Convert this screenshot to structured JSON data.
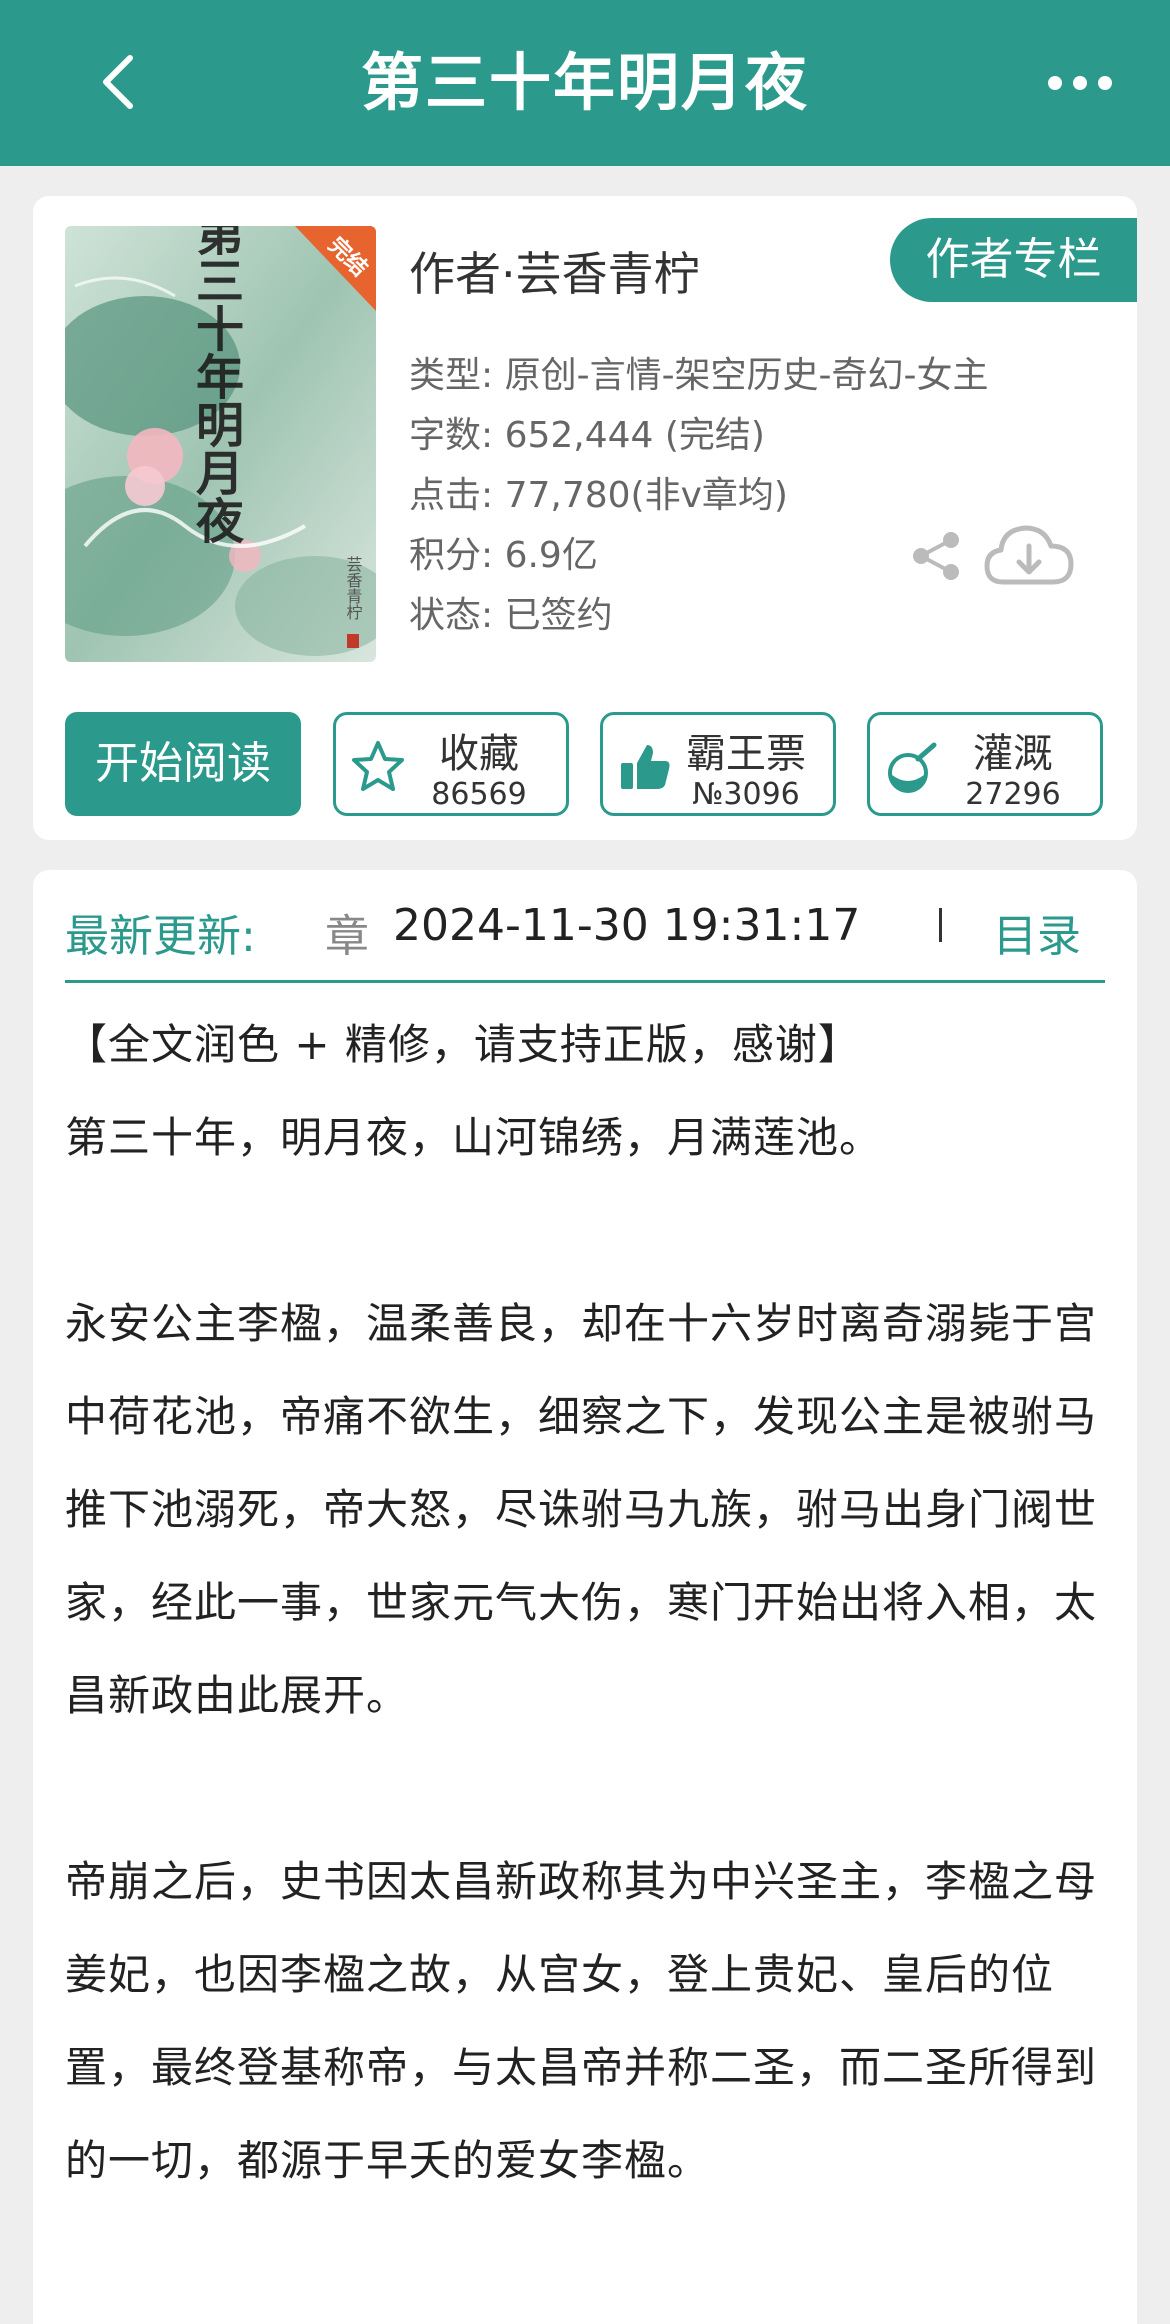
{
  "header": {
    "title": "第三十年明月夜"
  },
  "book": {
    "cover_badge": "完结",
    "cover_title": "第三十年明月夜",
    "cover_author": "芸香青柠",
    "author_line": "作者·芸香青柠",
    "author_column_label": "作者专栏",
    "info": [
      "类型: 原创-言情-架空历史-奇幻-女主",
      "字数: 652,444 (完结)",
      "点击: 77,780(非v章均)",
      "积分: 6.9亿",
      "状态: 已签约"
    ]
  },
  "actions": {
    "read_label": "开始阅读",
    "collect": {
      "label": "收藏",
      "value": "86569"
    },
    "bawang": {
      "label": "霸王票",
      "value": "№3096"
    },
    "guangai": {
      "label": "灌溉",
      "value": "27296"
    }
  },
  "update": {
    "label": "最新更新:",
    "chapter": "章",
    "time": "2024-11-30 19:31:17",
    "toc_label": "目录"
  },
  "intro": [
    "【全文润色 + 精修，请支持正版，感谢】",
    "第三十年，明月夜，山河锦绣，月满莲池。",
    "",
    "永安公主李楹，温柔善良，却在十六岁时离奇溺毙于宫中荷花池，帝痛不欲生，细察之下，发现公主是被驸马推下池溺死，帝大怒，尽诛驸马九族，驸马出身门阀世家，经此一事，世家元气大伤，寒门开始出将入相，太昌新政由此展开。",
    "",
    "帝崩之后，史书因太昌新政称其为中兴圣主，李楹之母姜妃，也因李楹之故，从宫女，登上贵妃、皇后的位置，最终登基称帝，与太昌帝并称二圣，而二圣所得到的一切，都源于早夭的爱女李楹。"
  ],
  "colors": {
    "accent": "#2b9a8c"
  }
}
